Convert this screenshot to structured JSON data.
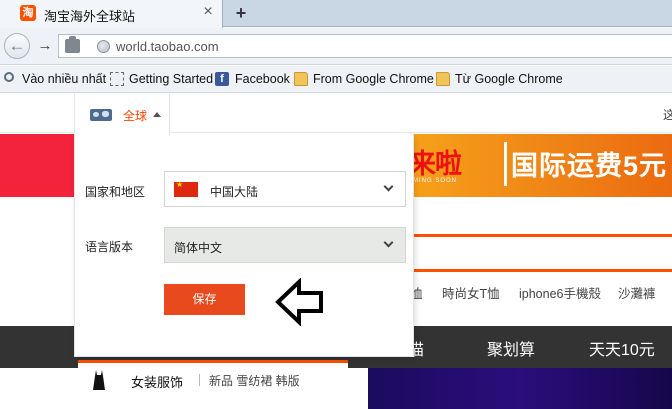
{
  "browser": {
    "tab": {
      "favicon": "淘",
      "title": "淘宝海外全球站",
      "close": "×"
    },
    "new_tab": "+",
    "nav": {
      "back": "←",
      "forward": "→"
    },
    "url": "world.taobao.com",
    "bookmarks": [
      {
        "label": "Vào nhiều nhất",
        "icon": "search-icon"
      },
      {
        "label": "Getting Started",
        "icon": "dashed-box-icon"
      },
      {
        "label": "Facebook",
        "icon": "facebook-icon"
      },
      {
        "label": "From Google Chrome",
        "icon": "folder-icon"
      },
      {
        "label": "Từ Google Chrome",
        "icon": "folder-icon"
      }
    ]
  },
  "region_selector": {
    "label": "全球",
    "icon": "world-map-icon"
  },
  "panel": {
    "country_label": "国家和地区",
    "country_value": "中国大陆",
    "country_flag": "china-flag-icon",
    "language_label": "语言版本",
    "language_value": "简体中文",
    "save_label": "保存",
    "pointer_icon": "left-arrow-outline-icon"
  },
  "page": {
    "banner_left_text": "来啦",
    "banner_sub_text": "MING SOON",
    "banner_right_text": "国际运费5元",
    "topbar_right_text": "这",
    "hot_searches": [
      "恤",
      "時尚女T恤",
      "iphone6手機殼",
      "沙灘褲"
    ],
    "nav_items": [
      "猫",
      "聚划算",
      "天天10元"
    ],
    "category": {
      "title": "女装服饰",
      "subs": "新品 雪纺裙 韩版"
    }
  },
  "colors": {
    "taobao_orange": "#ff5000",
    "save_button": "#e8491d",
    "banner_red": "#f2233a",
    "nav_dark": "#333333"
  }
}
